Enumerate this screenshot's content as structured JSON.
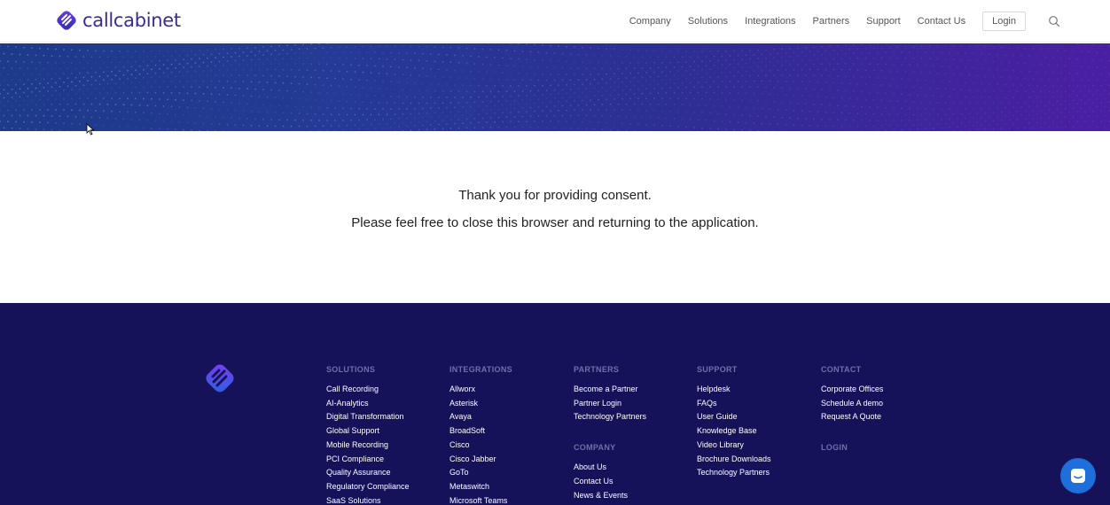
{
  "brand": {
    "name": "callcabinet",
    "color": "#3b2a9a"
  },
  "nav": {
    "items": [
      "Company",
      "Solutions",
      "Integrations",
      "Partners",
      "Support",
      "Contact Us"
    ],
    "login": "Login"
  },
  "message": {
    "line1": "Thank you for providing consent.",
    "line2": "Please feel free to close this browser and returning to the application."
  },
  "footer": {
    "background": "#15125a",
    "solutions": {
      "title": "SOLUTIONS",
      "links": [
        "Call Recording",
        "AI-Analytics",
        "Digital Transformation",
        "Global Support",
        "Mobile Recording",
        "PCI Compliance",
        "Quality Assurance",
        "Regulatory Compliance",
        "SaaS Solutions"
      ]
    },
    "integrations": {
      "title": "INTEGRATIONS",
      "links": [
        "Allworx",
        "Asterisk",
        "Avaya",
        "BroadSoft",
        "Cisco",
        "Cisco Jabber",
        "GoTo",
        "Metaswitch",
        "Microsoft Teams"
      ]
    },
    "partners": {
      "title": "PARTNERS",
      "links": [
        "Become a Partner",
        "Partner Login",
        "Technology Partners"
      ]
    },
    "company": {
      "title": "COMPANY",
      "links": [
        "About Us",
        "Contact Us",
        "News & Events"
      ]
    },
    "support": {
      "title": "SUPPORT",
      "links": [
        "Helpdesk",
        "FAQs",
        "User Guide",
        "Knowledge Base",
        "Video Library",
        "Brochure Downloads",
        "Technology Partners"
      ]
    },
    "contact": {
      "title": "CONTACT",
      "links": [
        "Corporate Offices",
        "Schedule A demo",
        "Request A Quote"
      ]
    },
    "login": {
      "title": "LOGIN"
    }
  },
  "icons": {
    "search": "search-icon",
    "chat": "chat-icon",
    "logo": "callcabinet-logo-icon"
  }
}
